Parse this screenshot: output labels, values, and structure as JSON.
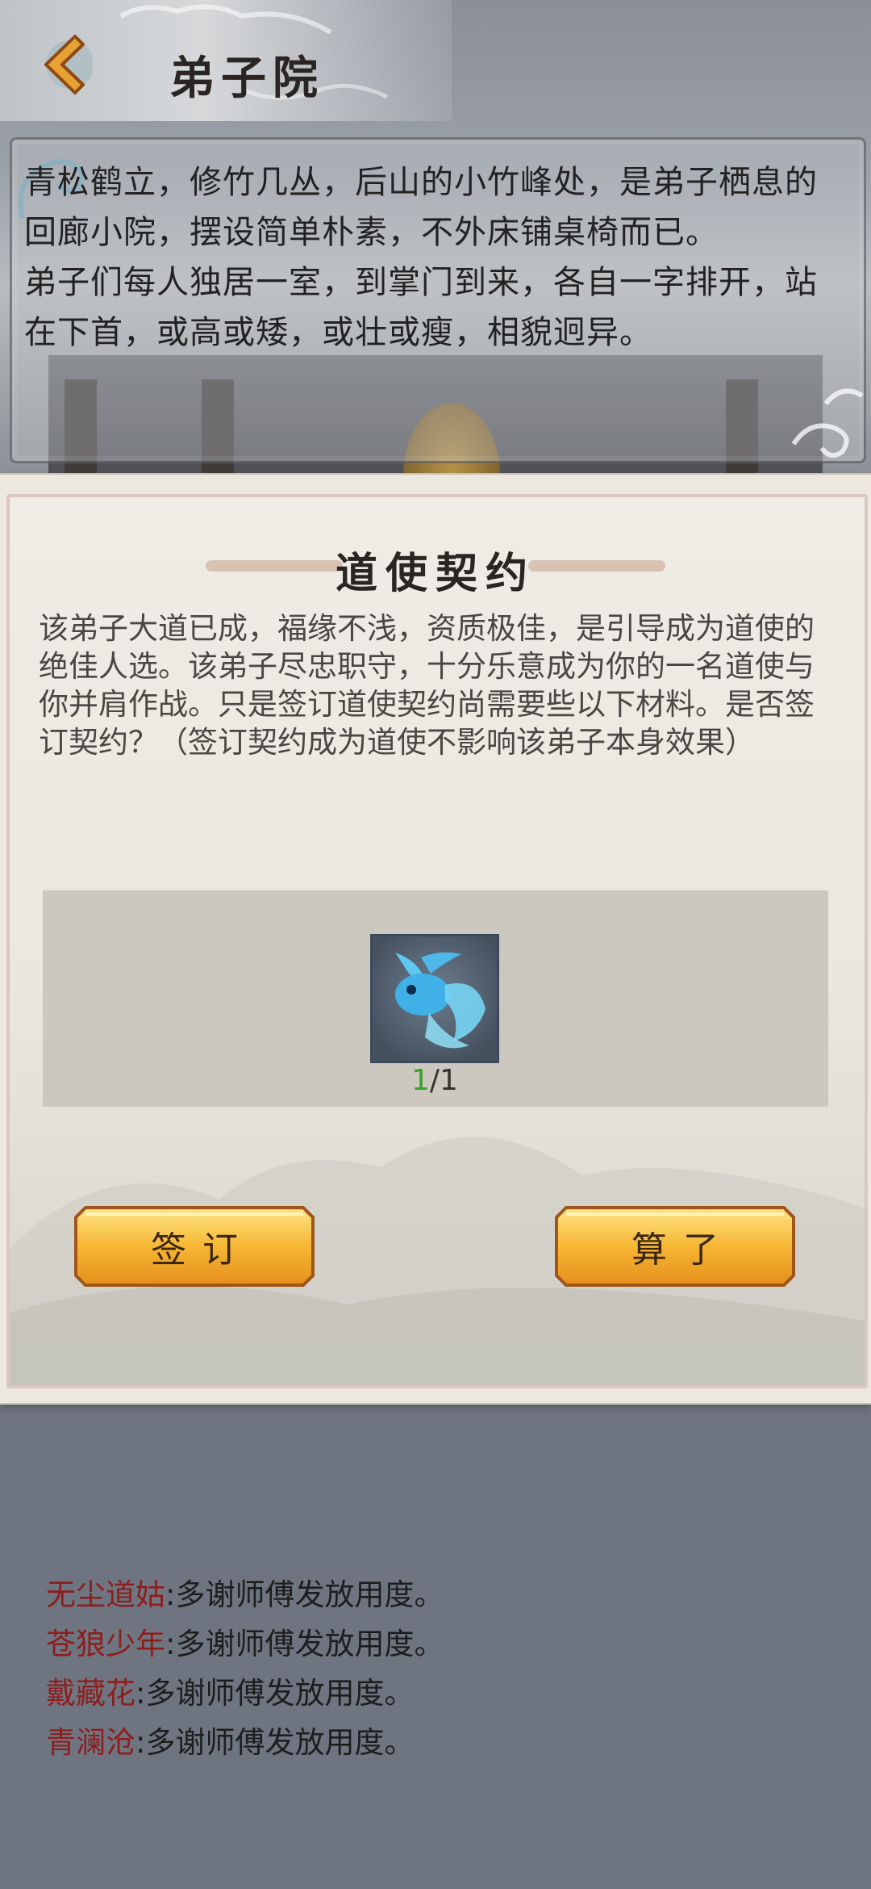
{
  "header": {
    "title": "弟子院",
    "back_icon": "back-arrow-icon"
  },
  "description": {
    "paragraphs": [
      "青松鹤立，修竹几丛，后山的小竹峰处，是弟子栖息的回廊小院，摆设简单朴素，不外床铺桌椅而已。",
      "弟子们每人独居一室，到掌门到来，各自一字排开，站在下首，或高或矮，或壮或瘦，相貌迥异。"
    ]
  },
  "dialog": {
    "title": "道使契约",
    "body": "该弟子大道已成，福缘不浅，资质极佳，是引导成为道使的绝佳人选。该弟子尽忠职守，十分乐意成为你的一名道使与你并肩作战。只是签订道使契约尚需要些以下材料。是否签订契约？（签订契约成为道使不影响该弟子本身效果）",
    "material": {
      "icon": "blue-fish-icon",
      "have": "1",
      "need": "/1"
    },
    "sign_label": "签订",
    "cancel_label": "算了"
  },
  "chat": [
    {
      "speaker": "无尘道姑",
      "message": ":多谢师傅发放用度。"
    },
    {
      "speaker": "苍狼少年",
      "message": ":多谢师傅发放用度。"
    },
    {
      "speaker": "戴藏花",
      "message": ":多谢师傅发放用度。"
    },
    {
      "speaker": "青澜沧",
      "message": ":多谢师傅发放用度。"
    }
  ],
  "colors": {
    "speaker": "#8e1d1d",
    "have_count": "#3aa12b",
    "button_gold": "#f3b530"
  }
}
